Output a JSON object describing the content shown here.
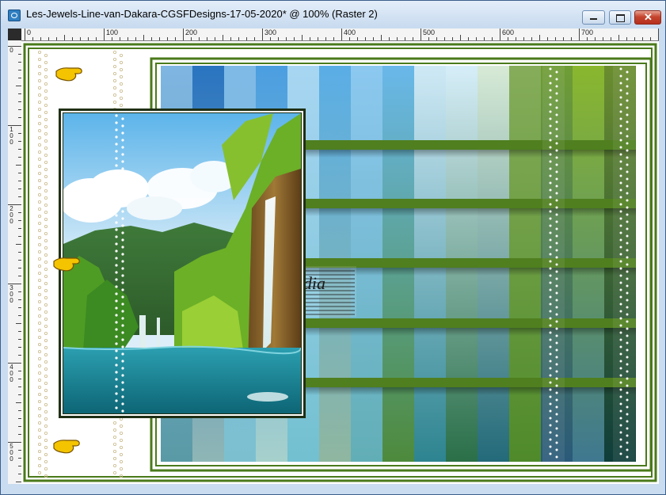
{
  "window": {
    "title": "Les-Jewels-Line-van-Dakara-CGSFDesigns-17-05-2020* @ 100% (Raster 2)",
    "buttons": {
      "minimize": "minimize-icon",
      "maximize": "maximize-icon",
      "close": "✕"
    }
  },
  "ruler": {
    "top_labels": [
      "0",
      "100",
      "200",
      "300",
      "400",
      "500",
      "600",
      "700"
    ],
    "left_labels": [
      "0",
      "100",
      "200",
      "300",
      "400",
      "500"
    ]
  },
  "canvas": {
    "pointer_icon": "pointing-hand-icon",
    "watermark_text": "claudia",
    "photo_subject": "waterfall-landscape-image",
    "colors": {
      "frame_green": "#4a7a1a",
      "bar_green": "#4f7f1f",
      "frame_dark": "#1f2f14",
      "sky_blue": "#4aa8e0",
      "teal": "#1a6a7a"
    }
  }
}
